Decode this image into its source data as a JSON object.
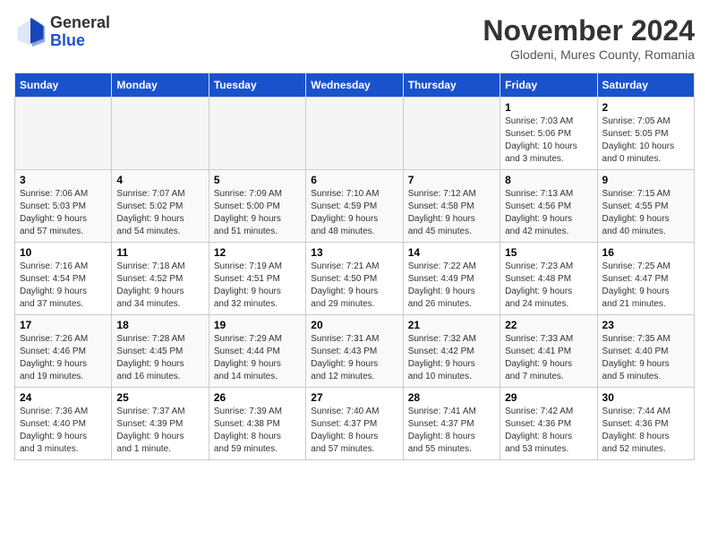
{
  "logo": {
    "general": "General",
    "blue": "Blue"
  },
  "header": {
    "month": "November 2024",
    "location": "Glodeni, Mures County, Romania"
  },
  "weekdays": [
    "Sunday",
    "Monday",
    "Tuesday",
    "Wednesday",
    "Thursday",
    "Friday",
    "Saturday"
  ],
  "weeks": [
    [
      {
        "day": "",
        "info": ""
      },
      {
        "day": "",
        "info": ""
      },
      {
        "day": "",
        "info": ""
      },
      {
        "day": "",
        "info": ""
      },
      {
        "day": "",
        "info": ""
      },
      {
        "day": "1",
        "info": "Sunrise: 7:03 AM\nSunset: 5:06 PM\nDaylight: 10 hours\nand 3 minutes."
      },
      {
        "day": "2",
        "info": "Sunrise: 7:05 AM\nSunset: 5:05 PM\nDaylight: 10 hours\nand 0 minutes."
      }
    ],
    [
      {
        "day": "3",
        "info": "Sunrise: 7:06 AM\nSunset: 5:03 PM\nDaylight: 9 hours\nand 57 minutes."
      },
      {
        "day": "4",
        "info": "Sunrise: 7:07 AM\nSunset: 5:02 PM\nDaylight: 9 hours\nand 54 minutes."
      },
      {
        "day": "5",
        "info": "Sunrise: 7:09 AM\nSunset: 5:00 PM\nDaylight: 9 hours\nand 51 minutes."
      },
      {
        "day": "6",
        "info": "Sunrise: 7:10 AM\nSunset: 4:59 PM\nDaylight: 9 hours\nand 48 minutes."
      },
      {
        "day": "7",
        "info": "Sunrise: 7:12 AM\nSunset: 4:58 PM\nDaylight: 9 hours\nand 45 minutes."
      },
      {
        "day": "8",
        "info": "Sunrise: 7:13 AM\nSunset: 4:56 PM\nDaylight: 9 hours\nand 42 minutes."
      },
      {
        "day": "9",
        "info": "Sunrise: 7:15 AM\nSunset: 4:55 PM\nDaylight: 9 hours\nand 40 minutes."
      }
    ],
    [
      {
        "day": "10",
        "info": "Sunrise: 7:16 AM\nSunset: 4:54 PM\nDaylight: 9 hours\nand 37 minutes."
      },
      {
        "day": "11",
        "info": "Sunrise: 7:18 AM\nSunset: 4:52 PM\nDaylight: 9 hours\nand 34 minutes."
      },
      {
        "day": "12",
        "info": "Sunrise: 7:19 AM\nSunset: 4:51 PM\nDaylight: 9 hours\nand 32 minutes."
      },
      {
        "day": "13",
        "info": "Sunrise: 7:21 AM\nSunset: 4:50 PM\nDaylight: 9 hours\nand 29 minutes."
      },
      {
        "day": "14",
        "info": "Sunrise: 7:22 AM\nSunset: 4:49 PM\nDaylight: 9 hours\nand 26 minutes."
      },
      {
        "day": "15",
        "info": "Sunrise: 7:23 AM\nSunset: 4:48 PM\nDaylight: 9 hours\nand 24 minutes."
      },
      {
        "day": "16",
        "info": "Sunrise: 7:25 AM\nSunset: 4:47 PM\nDaylight: 9 hours\nand 21 minutes."
      }
    ],
    [
      {
        "day": "17",
        "info": "Sunrise: 7:26 AM\nSunset: 4:46 PM\nDaylight: 9 hours\nand 19 minutes."
      },
      {
        "day": "18",
        "info": "Sunrise: 7:28 AM\nSunset: 4:45 PM\nDaylight: 9 hours\nand 16 minutes."
      },
      {
        "day": "19",
        "info": "Sunrise: 7:29 AM\nSunset: 4:44 PM\nDaylight: 9 hours\nand 14 minutes."
      },
      {
        "day": "20",
        "info": "Sunrise: 7:31 AM\nSunset: 4:43 PM\nDaylight: 9 hours\nand 12 minutes."
      },
      {
        "day": "21",
        "info": "Sunrise: 7:32 AM\nSunset: 4:42 PM\nDaylight: 9 hours\nand 10 minutes."
      },
      {
        "day": "22",
        "info": "Sunrise: 7:33 AM\nSunset: 4:41 PM\nDaylight: 9 hours\nand 7 minutes."
      },
      {
        "day": "23",
        "info": "Sunrise: 7:35 AM\nSunset: 4:40 PM\nDaylight: 9 hours\nand 5 minutes."
      }
    ],
    [
      {
        "day": "24",
        "info": "Sunrise: 7:36 AM\nSunset: 4:40 PM\nDaylight: 9 hours\nand 3 minutes."
      },
      {
        "day": "25",
        "info": "Sunrise: 7:37 AM\nSunset: 4:39 PM\nDaylight: 9 hours\nand 1 minute."
      },
      {
        "day": "26",
        "info": "Sunrise: 7:39 AM\nSunset: 4:38 PM\nDaylight: 8 hours\nand 59 minutes."
      },
      {
        "day": "27",
        "info": "Sunrise: 7:40 AM\nSunset: 4:37 PM\nDaylight: 8 hours\nand 57 minutes."
      },
      {
        "day": "28",
        "info": "Sunrise: 7:41 AM\nSunset: 4:37 PM\nDaylight: 8 hours\nand 55 minutes."
      },
      {
        "day": "29",
        "info": "Sunrise: 7:42 AM\nSunset: 4:36 PM\nDaylight: 8 hours\nand 53 minutes."
      },
      {
        "day": "30",
        "info": "Sunrise: 7:44 AM\nSunset: 4:36 PM\nDaylight: 8 hours\nand 52 minutes."
      }
    ]
  ]
}
